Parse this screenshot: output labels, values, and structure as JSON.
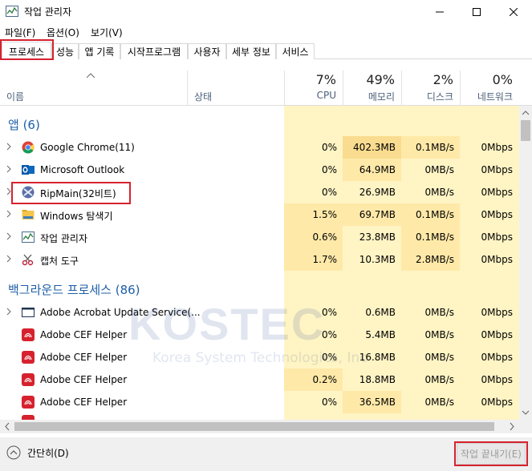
{
  "window": {
    "title": "작업 관리자"
  },
  "menu": [
    "파일(F)",
    "옵션(O)",
    "보기(V)"
  ],
  "tabs": [
    "프로세스",
    "성능",
    "앱 기록",
    "시작프로그램",
    "사용자",
    "세부 정보",
    "서비스"
  ],
  "columns": {
    "name": "이름",
    "status": "상태",
    "cpu": {
      "pct": "7%",
      "label": "CPU"
    },
    "memory": {
      "pct": "49%",
      "label": "메모리"
    },
    "disk": {
      "pct": "2%",
      "label": "디스크"
    },
    "network": {
      "pct": "0%",
      "label": "네트워크"
    }
  },
  "groups": {
    "apps": "앱 (6)",
    "background": "백그라운드 프로세스 (86)"
  },
  "apps": [
    {
      "name": "Google Chrome(11)",
      "icon": "chrome-icon",
      "cpu": "0%",
      "mem": "402.3MB",
      "disk": "0.1MB/s",
      "net": "0Mbps"
    },
    {
      "name": "Microsoft Outlook",
      "icon": "outlook-icon",
      "cpu": "0%",
      "mem": "64.9MB",
      "disk": "0MB/s",
      "net": "0Mbps"
    },
    {
      "name": "RipMain(32비트)",
      "icon": "ripmain-icon",
      "cpu": "0%",
      "mem": "26.9MB",
      "disk": "0MB/s",
      "net": "0Mbps"
    },
    {
      "name": "Windows 탐색기",
      "icon": "folder-icon",
      "cpu": "1.5%",
      "mem": "69.7MB",
      "disk": "0.1MB/s",
      "net": "0Mbps"
    },
    {
      "name": "작업 관리자",
      "icon": "task-manager-icon",
      "cpu": "0.6%",
      "mem": "23.8MB",
      "disk": "0.1MB/s",
      "net": "0Mbps"
    },
    {
      "name": "캡처 도구",
      "icon": "snipping-tool-icon",
      "cpu": "1.7%",
      "mem": "10.3MB",
      "disk": "2.8MB/s",
      "net": "0Mbps"
    }
  ],
  "background": [
    {
      "name": "Adobe Acrobat Update Service(...",
      "icon": "window-icon",
      "cpu": "0%",
      "mem": "0.6MB",
      "disk": "0MB/s",
      "net": "0Mbps"
    },
    {
      "name": "Adobe CEF Helper",
      "icon": "adobe-cef-icon",
      "cpu": "0%",
      "mem": "5.4MB",
      "disk": "0MB/s",
      "net": "0Mbps"
    },
    {
      "name": "Adobe CEF Helper",
      "icon": "adobe-cef-icon",
      "cpu": "0%",
      "mem": "16.8MB",
      "disk": "0MB/s",
      "net": "0Mbps"
    },
    {
      "name": "Adobe CEF Helper",
      "icon": "adobe-cef-icon",
      "cpu": "0.2%",
      "mem": "18.8MB",
      "disk": "0MB/s",
      "net": "0Mbps"
    },
    {
      "name": "Adobe CEF Helper",
      "icon": "adobe-cef-icon",
      "cpu": "0%",
      "mem": "36.5MB",
      "disk": "0MB/s",
      "net": "0Mbps"
    }
  ],
  "footer": {
    "fewer_details": "간단히(D)",
    "end_task": "작업 끝내기(E)"
  },
  "watermark": {
    "logo": "KOSTEC",
    "tagline": "Korea System Technologies, Inc"
  },
  "colors": {
    "accent_red": "#d6222e",
    "group_blue": "#1e5fa8",
    "heat_light": "#fff4c4",
    "heat_mid": "#ffe9a8",
    "heat_strong": "#f9dc8f"
  }
}
